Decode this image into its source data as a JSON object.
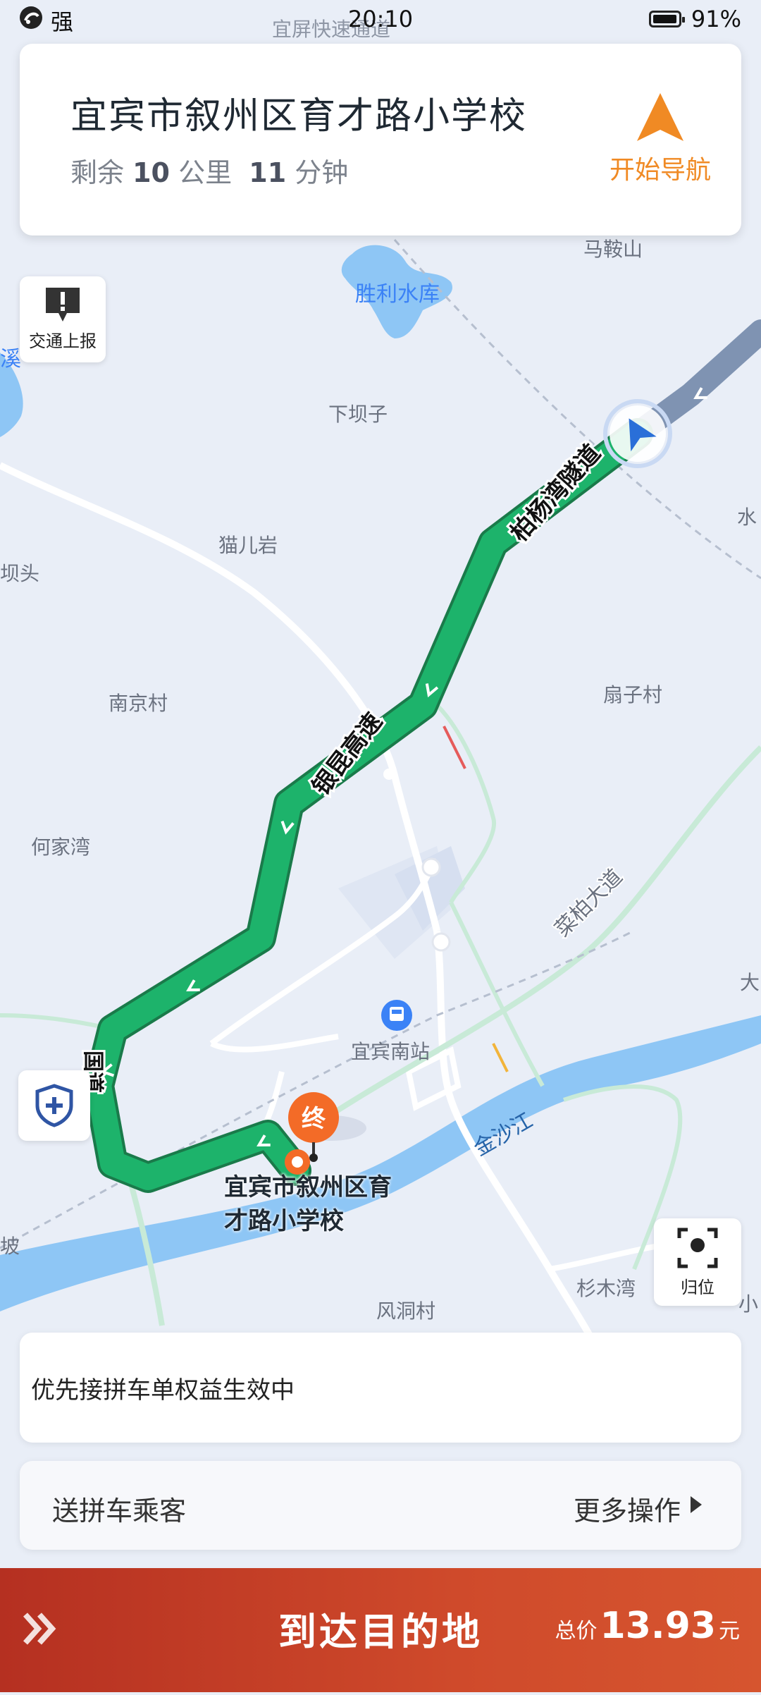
{
  "status_bar": {
    "signal": "强",
    "time": "20:10",
    "battery": "91%"
  },
  "destination": {
    "title": "宜宾市叙州区育才路小学校",
    "remaining_label": "剩余",
    "distance": "10",
    "distance_unit": "公里",
    "duration": "11",
    "duration_unit": "分钟",
    "nav_button": "开始导航"
  },
  "buttons": {
    "traffic_report": "交通上报",
    "locate": "归位"
  },
  "map": {
    "labels": [
      "宜屏快速通道",
      "马鞍山",
      "胜利水库",
      "下坝子",
      "猫儿岩",
      "南京村",
      "扇子村",
      "何家湾",
      "宜宾南站",
      "金沙江",
      "风洞村",
      "杉木湾",
      "水",
      "坝头",
      "大",
      "坡",
      "小",
      "溪"
    ],
    "roads": [
      "柏杨湾隧道",
      "银昆高速",
      "菜柏大道",
      "国道"
    ],
    "end_marker": "终",
    "end_label_line1": "宜宾市叙州区育",
    "end_label_line2": "才路小学校"
  },
  "info": {
    "notice": "优先接拼车单权益生效中"
  },
  "actions": {
    "left": "送拼车乘客",
    "right": "更多操作"
  },
  "bottom": {
    "main": "到达目的地",
    "price_label": "总价",
    "price": "13.93",
    "price_unit": "元"
  },
  "colors": {
    "route": "#1db36b",
    "accent": "#f08a24",
    "bottom": "#c23b24",
    "water": "#8ec6f5"
  }
}
